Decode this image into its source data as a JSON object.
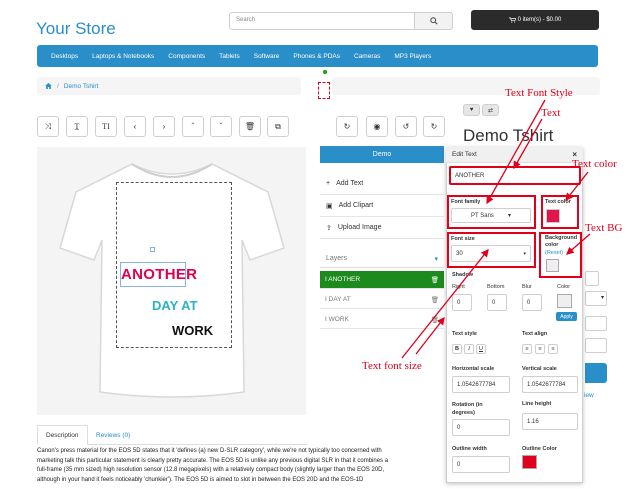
{
  "store": {
    "title": "Your Store"
  },
  "search": {
    "placeholder": "Search"
  },
  "cart": {
    "label": "0 item(s) - $0.00"
  },
  "nav": {
    "items": [
      "Desktops",
      "Laptops & Notebooks",
      "Components",
      "Tablets",
      "Software",
      "Phones & PDAs",
      "Cameras",
      "MP3 Players"
    ]
  },
  "breadcrumb": {
    "item": "Demo Tshirt",
    "separator": "/"
  },
  "product": {
    "title": "Demo Tshirt"
  },
  "canvas": {
    "line1": "ANOTHER",
    "line2": "DAY AT",
    "line3": "WORK",
    "colors": {
      "line1": "#e0004d",
      "line2": "#2ab3c4",
      "line3": "#111111"
    }
  },
  "designer": {
    "demo_tab": "Demo",
    "add_text": "Add Text",
    "add_clipart": "Add Clipart",
    "upload_image": "Upload Image",
    "layers_label": "Layers",
    "layers": [
      "ANOTHER",
      "DAY AT",
      "WORK"
    ]
  },
  "edit_text": {
    "title": "Edit Text",
    "close": "×",
    "text_value": "ANOTHER",
    "font_family_label": "Font family",
    "font_family_value": "PT Sans",
    "text_color_label": "Text color",
    "text_color": "#e0154a",
    "font_size_label": "Font size",
    "font_size_value": "30",
    "bg_color_label": "Background color",
    "bg_reset": "(Reset)",
    "shadow_label": "Shadow",
    "shadow_right_label": "Right",
    "shadow_right": "0",
    "shadow_bottom_label": "Bottom",
    "shadow_bottom": "0",
    "shadow_blur_label": "Blur",
    "shadow_blur": "0",
    "shadow_color_label": "Color",
    "apply_label": "Apply",
    "text_style_label": "Text style",
    "text_align_label": "Text align",
    "h_scale_label": "Horizontal scale",
    "h_scale": "1.0542677784",
    "v_scale_label": "Vertical scale",
    "v_scale": "1.0542677784",
    "rotation_label": "Rotation (in degrees)",
    "rotation": "0",
    "line_height_label": "Line height",
    "line_height": "1.16",
    "outline_width_label": "Outline width",
    "outline_width": "0",
    "outline_color_label": "Outline Color",
    "outline_color": "#e0001b"
  },
  "annotations": {
    "font_style": "Text Font Style",
    "text": "Text",
    "text_color": "Text color",
    "text_bg": "Text BG",
    "font_size": "Text font size"
  },
  "tabs": {
    "description": "Description",
    "reviews": "Reviews (0)"
  },
  "description": {
    "lines": [
      "Canon's press material for the EOS 5D states that it 'defines (a) new D-SLR category', while we're not typically too concerned with",
      "marketing talk this particular statement is clearly pretty accurate. The EOS 5D is unlike any previous digital SLR in that it combines a",
      "full-frame (35 mm sized) high resolution sensor (12.8 megapixels) with a relatively compact body (slightly larger than the EOS 20D,",
      "although in your hand it feels noticeably 'chunkier'). The EOS 5D is aimed to slot in between the EOS 20D and the EOS-1D"
    ]
  },
  "side": {
    "view_link": "iew"
  },
  "colors": {
    "brand": "#2a8ec9",
    "annotation": "#e0001b",
    "active_layer": "#1c8a1c"
  }
}
